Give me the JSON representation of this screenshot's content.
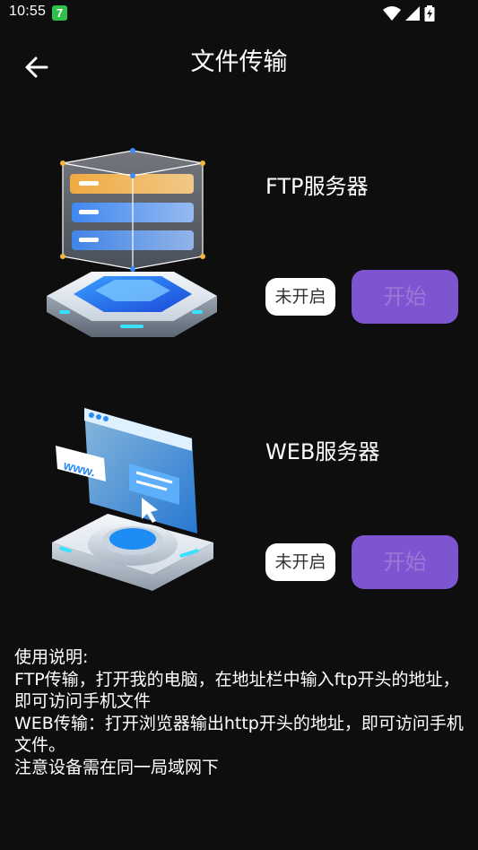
{
  "status_bar": {
    "time": "10:55",
    "badge": "7",
    "icons": [
      "wifi-icon",
      "signal-icon",
      "battery-charging-icon"
    ]
  },
  "header": {
    "title": "文件传输",
    "back_icon": "arrow-left-icon"
  },
  "servers": [
    {
      "name": "FTP服务器",
      "status": "未开启",
      "button_label": "开始",
      "illustration": "server-stack-illustration"
    },
    {
      "name": "WEB服务器",
      "status": "未开启",
      "button_label": "开始",
      "illustration": "browser-window-illustration"
    }
  ],
  "instructions": {
    "title": "使用说明:",
    "line1": "FTP传输，打开我的电脑，在地址栏中输入ftp开头的地址，即可访问手机文件",
    "line2": "WEB传输：打开浏览器输出http开头的地址，即可访问手机文件。",
    "line3": "注意设备需在同一局域网下"
  },
  "colors": {
    "background": "#0e0e0f",
    "start_button": "#7d55d0",
    "start_button_text": "#9a78d8",
    "status_pill": "#ffffff",
    "badge": "#2fbf4a"
  }
}
